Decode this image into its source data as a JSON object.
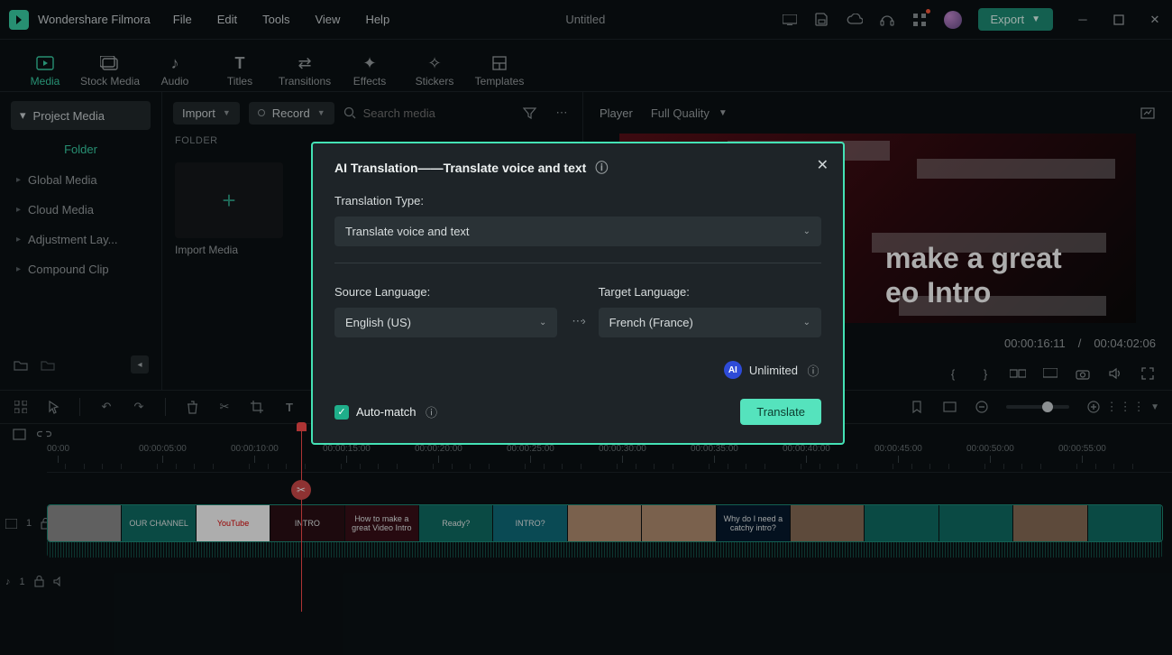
{
  "app": {
    "name": "Wondershare Filmora",
    "document": "Untitled"
  },
  "menu": {
    "file": "File",
    "edit": "Edit",
    "tools": "Tools",
    "view": "View",
    "help": "Help"
  },
  "export": {
    "label": "Export"
  },
  "tabs": {
    "media": "Media",
    "stock": "Stock Media",
    "audio": "Audio",
    "titles": "Titles",
    "transitions": "Transitions",
    "effects": "Effects",
    "stickers": "Stickers",
    "templates": "Templates"
  },
  "sidebar": {
    "project_media": "Project Media",
    "folder": "Folder",
    "global": "Global Media",
    "cloud": "Cloud Media",
    "adjustment": "Adjustment Lay...",
    "compound": "Compound Clip"
  },
  "mediabar": {
    "import": "Import",
    "record": "Record",
    "search_placeholder": "Search media",
    "folder_label": "FOLDER",
    "import_media": "Import Media"
  },
  "player": {
    "label": "Player",
    "quality": "Full Quality",
    "preview_text1": "make a great",
    "preview_text2": "eo Intro",
    "current": "00:00:16:11",
    "sep": "/",
    "total": "00:04:02:06"
  },
  "ruler": {
    "labels": [
      "00:00",
      "00:00:05:00",
      "00:00:10:00",
      "00:00:15:00",
      "00:00:20:00",
      "00:00:25:00",
      "00:00:30:00",
      "00:00:35:00",
      "00:00:40:00",
      "00:00:45:00",
      "00:00:50:00",
      "00:00:55:00"
    ]
  },
  "track": {
    "video_label": "1",
    "audio_label": "1",
    "thumbs": [
      "",
      "OUR CHANNEL",
      "YouTube",
      "INTRO",
      "How to make a great Video Intro",
      "Ready?",
      "INTRO?",
      "",
      "",
      "Why do I need a catchy intro?",
      "",
      "",
      "",
      "",
      ""
    ]
  },
  "modal": {
    "title": "AI Translation——Translate voice and text",
    "type_label": "Translation Type:",
    "type_value": "Translate voice and text",
    "source_label": "Source Language:",
    "source_value": "English (US)",
    "target_label": "Target Language:",
    "target_value": "French (France)",
    "ai_badge": "AI",
    "unlimited": "Unlimited",
    "auto_match": "Auto-match",
    "translate": "Translate"
  },
  "colors": {
    "accent": "#3ad3a8"
  }
}
